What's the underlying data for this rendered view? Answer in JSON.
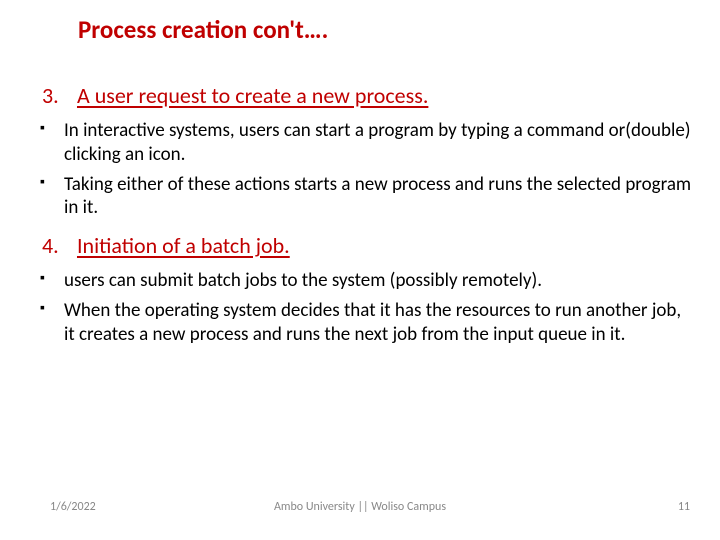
{
  "title": "Process creation con't….",
  "item3": {
    "num": "3.",
    "label": "A user request to create a new process.",
    "bullets": [
      "In interactive systems, users can start a program by typing a command or(double) clicking an icon.",
      "Taking either of these actions starts a new process and runs the selected program in it."
    ]
  },
  "item4": {
    "num": "4.",
    "label": "Initiation of a batch job.",
    "bullets": [
      "users can submit batch jobs to the system (possibly remotely).",
      " When the operating system decides that it has the resources to run another job, it creates a new process and runs the next job from the input queue in it."
    ]
  },
  "footer": {
    "date": "1/6/2022",
    "center": "Ambo University || Woliso Campus",
    "page": "11"
  }
}
